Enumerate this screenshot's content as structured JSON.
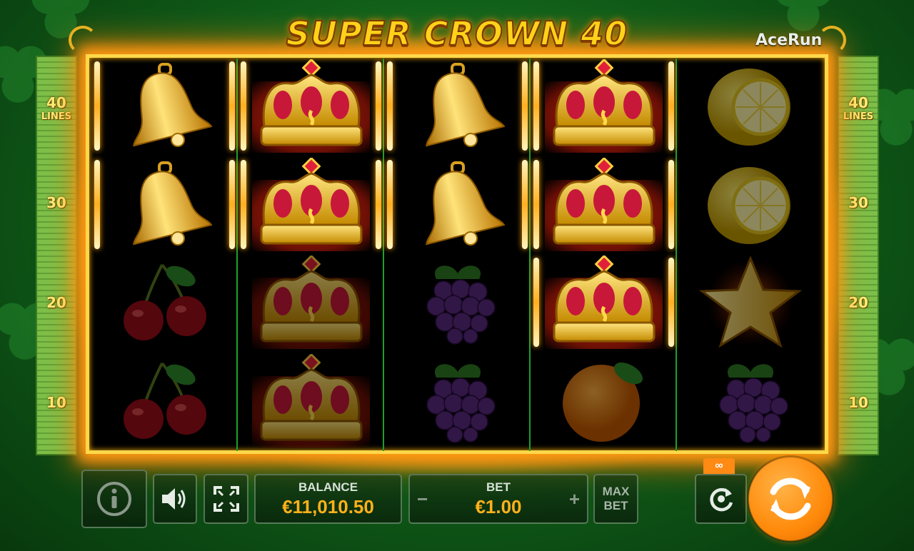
{
  "game": {
    "title": "SUPER CROWN 40",
    "provider_logo": "AceRun",
    "lines_total": "40",
    "lines_label": "LINES",
    "side_markers": [
      "30",
      "20",
      "10"
    ]
  },
  "reels": [
    [
      "bell-win",
      "bell-win",
      "cherries",
      "cherries"
    ],
    [
      "crown-win",
      "crown-win",
      "crown",
      "crown"
    ],
    [
      "bell-win",
      "bell-win",
      "grapes",
      "grapes"
    ],
    [
      "crown-win",
      "crown-win",
      "crown-win",
      "orange"
    ],
    [
      "lemon",
      "lemon",
      "star",
      "grapes"
    ]
  ],
  "controls": {
    "info_icon": "info-icon",
    "sound_icon": "speaker-icon",
    "fullscreen_icon": "fullscreen-icon",
    "balance_label": "BALANCE",
    "balance_value": "€11,010.50",
    "bet_label": "BET",
    "bet_value": "€1.00",
    "bet_minus": "−",
    "bet_plus": "+",
    "maxbet_line1": "MAX",
    "maxbet_line2": "BET",
    "autoplay_badge": "∞",
    "autoplay_icon": "autoplay-icon",
    "spin_icon": "spin-icon"
  },
  "colors": {
    "accent": "#ffb11a",
    "spin_button": "#ff8a0a",
    "frame_gold": "#ffd84a",
    "reel_divider": "#1aa12a"
  }
}
